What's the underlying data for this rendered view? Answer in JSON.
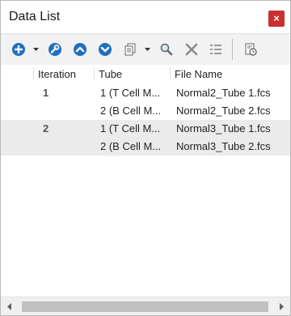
{
  "window": {
    "title": "Data List",
    "close_label": "×"
  },
  "toolbar": {
    "buttons": [
      {
        "icon": "add-icon",
        "label": "Add"
      },
      {
        "icon": "add-dropdown-icon",
        "label": ""
      },
      {
        "icon": "wrench-icon",
        "label": "Settings"
      },
      {
        "icon": "move-up-icon",
        "label": "Move Up"
      },
      {
        "icon": "move-down-icon",
        "label": "Move Down"
      },
      {
        "icon": "copy-icon",
        "label": "Copy"
      },
      {
        "icon": "copy-dropdown-icon",
        "label": ""
      },
      {
        "icon": "search-icon",
        "label": "Find"
      },
      {
        "icon": "delete-icon",
        "label": "Delete"
      },
      {
        "icon": "list-icon",
        "label": "List"
      },
      {
        "icon": "clock-document-icon",
        "label": "History"
      }
    ]
  },
  "columns": [
    "Iteration",
    "Tube",
    "File Name"
  ],
  "rows": [
    {
      "iteration": "1",
      "tube": "1 (T Cell M...",
      "file": "Normal2_Tube 1.fcs"
    },
    {
      "iteration": "",
      "tube": "2 (B Cell M...",
      "file": "Normal2_Tube 2.fcs"
    },
    {
      "iteration": "2",
      "tube": "1 (T Cell M...",
      "file": "Normal3_Tube 1.fcs"
    },
    {
      "iteration": "",
      "tube": "2 (B Cell M...",
      "file": "Normal3_Tube 2.fcs"
    }
  ],
  "colors": {
    "accent": "#1f6fbf",
    "close": "#c8312f",
    "row_alt": "#ebebeb"
  }
}
